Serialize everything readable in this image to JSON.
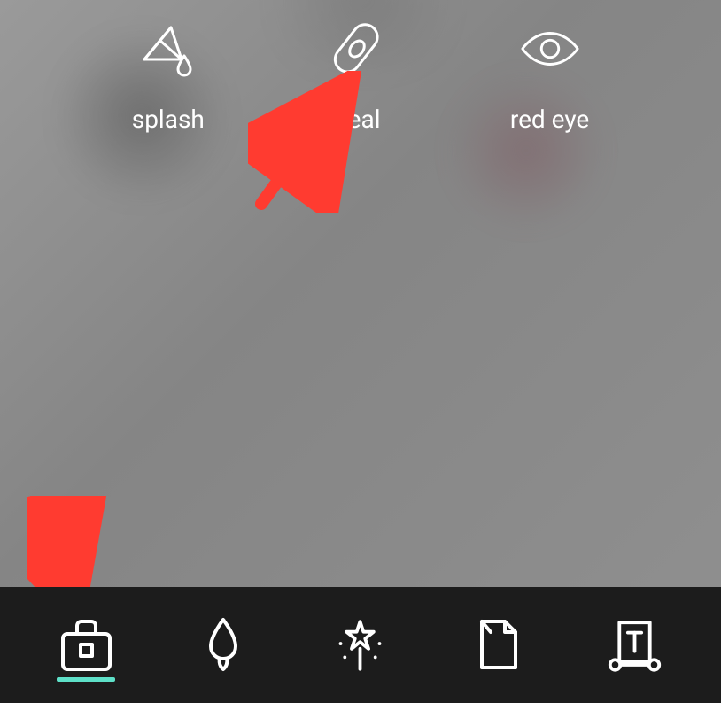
{
  "tools": {
    "splash": {
      "label": "splash"
    },
    "heal": {
      "label": "heal"
    },
    "redeye": {
      "label": "red eye"
    }
  },
  "nav": {
    "active_index": 0,
    "accent_color": "#5ee0c8"
  },
  "annotations": {
    "arrow_color": "#ff3b30"
  }
}
